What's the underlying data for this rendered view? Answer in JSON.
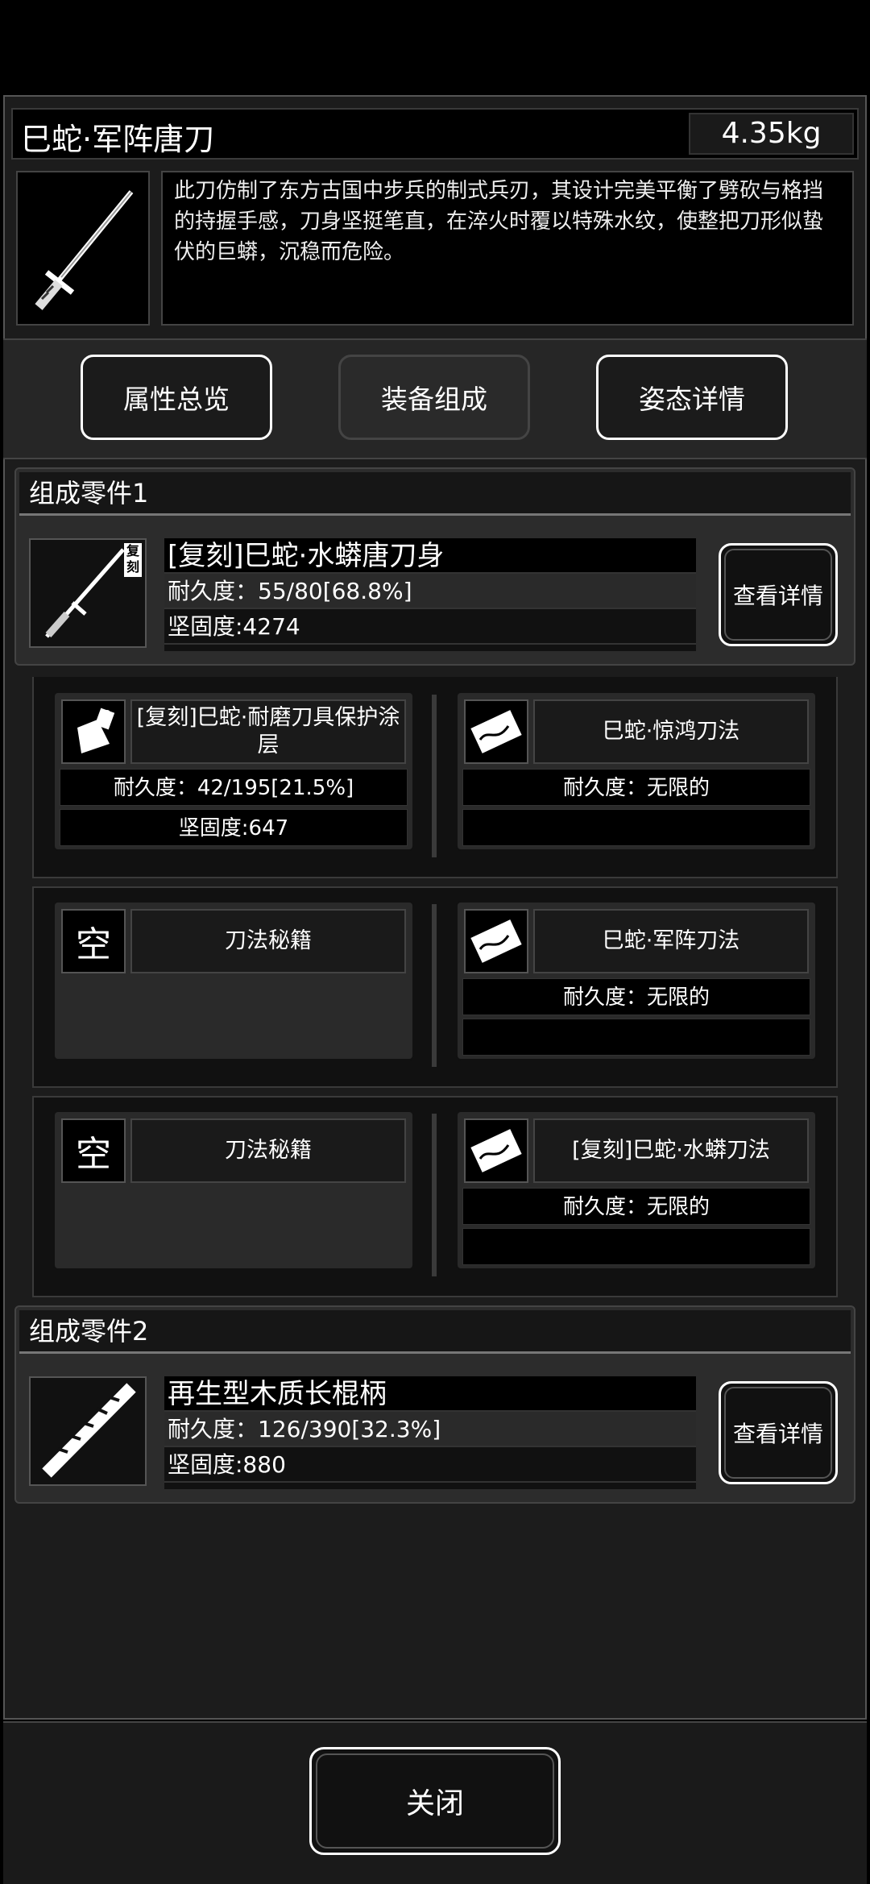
{
  "item": {
    "title": "巳蛇·军阵唐刀",
    "weight": "4.35kg",
    "description": "此刀仿制了东方古国中步兵的制式兵刃，其设计完美平衡了劈砍与格挡的持握手感，刀身坚挺笔直，在淬火时覆以特殊水纹，使整把刀形似蛰伏的巨蟒，沉稳而危险。",
    "icon": "katana-icon"
  },
  "tabs": [
    {
      "label": "属性总览",
      "active": false
    },
    {
      "label": "装备组成",
      "active": true
    },
    {
      "label": "姿态详情",
      "active": false
    }
  ],
  "parts": [
    {
      "header": "组成零件1",
      "name": "[复刻]巳蛇·水蟒唐刀身",
      "durability": "耐久度：55/80[68.8%]",
      "hardness": "坚固度:4274",
      "badge": "复刻",
      "icon": "blade-icon",
      "button": "查看详情"
    },
    {
      "header": "组成零件2",
      "name": "再生型木质长棍柄",
      "durability": "耐久度：126/390[32.3%]",
      "hardness": "坚固度:880",
      "icon": "wooden-handle-icon",
      "button": "查看详情"
    }
  ],
  "slot_groups": [
    {
      "left": {
        "name": "[复刻]巳蛇·耐磨刀具保护涂层",
        "line1": "耐久度：42/195[21.5%]",
        "line2": "坚固度:647",
        "icon": "coating-bottle-icon"
      },
      "right": {
        "name": "巳蛇·惊鸿刀法",
        "line1": "耐久度：无限的",
        "line2": "",
        "icon": "scroll-icon"
      }
    },
    {
      "left": {
        "name": "刀法秘籍",
        "empty_label": "空",
        "line1": "",
        "line2": ""
      },
      "right": {
        "name": "巳蛇·军阵刀法",
        "line1": "耐久度：无限的",
        "line2": "",
        "icon": "scroll-icon"
      }
    },
    {
      "left": {
        "name": "刀法秘籍",
        "empty_label": "空",
        "line1": "",
        "line2": ""
      },
      "right": {
        "name": "[复刻]巳蛇·水蟒刀法",
        "line1": "耐久度：无限的",
        "line2": "",
        "icon": "scroll-icon"
      }
    }
  ],
  "close_label": "关闭"
}
